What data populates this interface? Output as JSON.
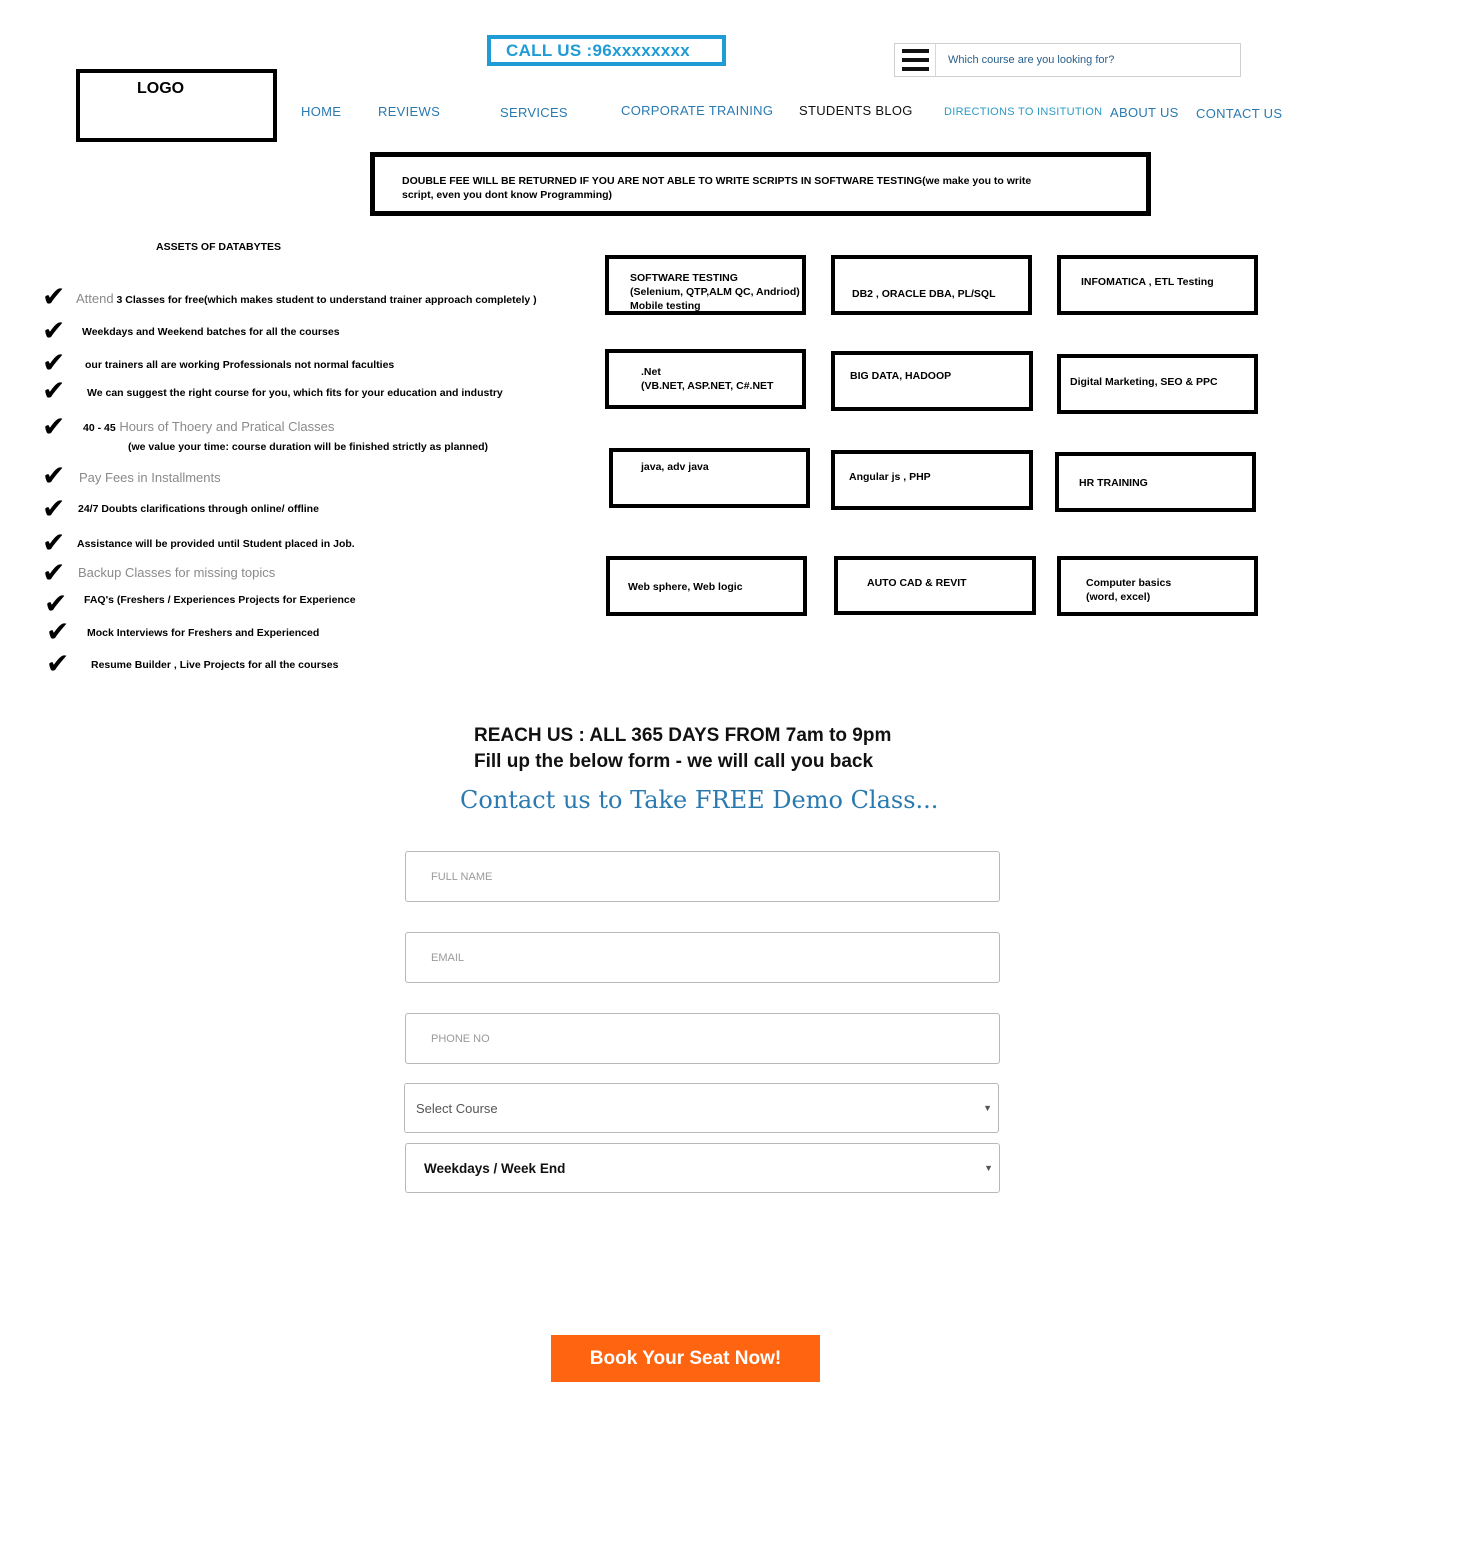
{
  "header": {
    "call_us": "CALL US :96xxxxxxxx",
    "search_placeholder": "Which course are you looking for?",
    "logo": "LOGO"
  },
  "nav": [
    "HOME",
    "REVIEWS",
    "SERVICES",
    "CORPORATE TRAINING",
    "STUDENTS BLOG",
    "DIRECTIONS TO INSITUTION",
    "ABOUT US",
    "CONTACT US"
  ],
  "notice": "DOUBLE FEE WILL BE RETURNED IF YOU ARE NOT ABLE TO WRITE SCRIPTS IN SOFTWARE TESTING(we make you to write script, even you dont know Programming)",
  "assets": {
    "title": "ASSETS OF DATABYTES",
    "items": [
      {
        "prefix": "Attend",
        "text": " 3  Classes for free(which makes student to understand trainer approach completely )"
      },
      {
        "text": "Weekdays and Weekend batches for all the courses"
      },
      {
        "text": "our trainers all are working Professionals not normal faculties"
      },
      {
        "text": "We  can  suggest the right course for you, which fits for your education and industry"
      },
      {
        "prefix_bold": "40 - 45",
        "text": " Hours of Thoery and Pratical Classes",
        "sub": "(we value your time: course duration will be finished strictly as planned)"
      },
      {
        "text": "Pay Fees in Installments"
      },
      {
        "text": "24/7 Doubts clarifications through online/ offline"
      },
      {
        "text": "Assistance will be provided until Student placed in Job."
      },
      {
        "text": "Backup Classes for missing topics"
      },
      {
        "text": "FAQ's (Freshers / Experiences Projects for Experience"
      },
      {
        "text": "Mock Interviews for Freshers and Experienced"
      },
      {
        "text": "Resume Builder , Live Projects for all the courses"
      }
    ]
  },
  "courses": [
    "SOFTWARE TESTING\n(Selenium, QTP,ALM QC, Andriod)\n   Mobile testing",
    "DB2   , ORACLE DBA, PL/SQL",
    "INFOMATICA   , ETL Testing",
    ".Net\n(VB.NET, ASP.NET, C#.NET",
    "BIG DATA, HADOOP",
    "Digital Marketing, SEO & PPC",
    "java, adv java",
    "Angular js  , PHP",
    "HR TRAINING",
    "Web sphere, Web logic",
    "AUTO CAD & REVIT",
    "Computer basics\n(word, excel)"
  ],
  "reach": {
    "line1": "REACH US :  ALL 365 DAYS FROM 7am to 9pm",
    "line2": "Fill up the below form - we will call you back",
    "contact_title": "Contact us to Take FREE Demo Class..."
  },
  "form": {
    "full_name_placeholder": "FULL NAME",
    "email_placeholder": "EMAIL",
    "phone_placeholder": "PHONE NO",
    "course_select": "Select Course",
    "batch_select": "Weekdays / Week End",
    "submit": "Book Your Seat Now!"
  }
}
